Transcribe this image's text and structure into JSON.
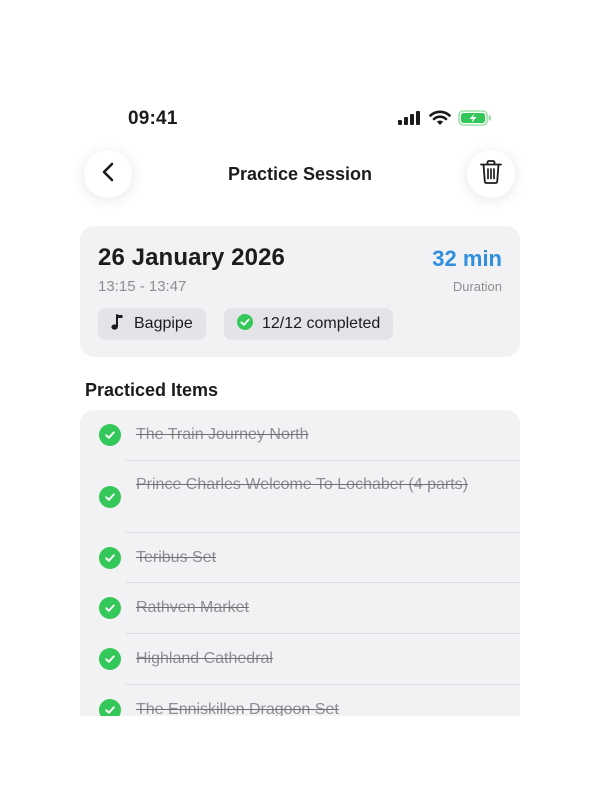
{
  "status_bar": {
    "time": "09:41",
    "icons": [
      "signal-icon",
      "wifi-icon",
      "battery-charging-icon"
    ],
    "battery_color": "#34c759"
  },
  "nav": {
    "title": "Practice Session",
    "back_icon": "chevron-left-icon",
    "delete_icon": "trash-icon"
  },
  "session": {
    "date": "26 January 2026",
    "time_range": "13:15 - 13:47",
    "duration": "32 min",
    "duration_label": "Duration",
    "instrument": "Bagpipe",
    "instrument_icon": "music-note-icon",
    "completed": "12/12 completed",
    "completed_icon": "check-circle-icon",
    "accent_color": "#2f8fde"
  },
  "practiced_items": {
    "title": "Practiced Items",
    "check_color": "#34c759",
    "items": [
      {
        "label": "The Train Journey North",
        "completed": true
      },
      {
        "label": "Prince Charles Welcome To Lochaber (4 parts)",
        "completed": true
      },
      {
        "label": "Teribus Set",
        "completed": true
      },
      {
        "label": "Rathven Market",
        "completed": true
      },
      {
        "label": "Highland Cathedral",
        "completed": true
      },
      {
        "label": "The Enniskillen Dragoon Set",
        "completed": true
      }
    ]
  }
}
